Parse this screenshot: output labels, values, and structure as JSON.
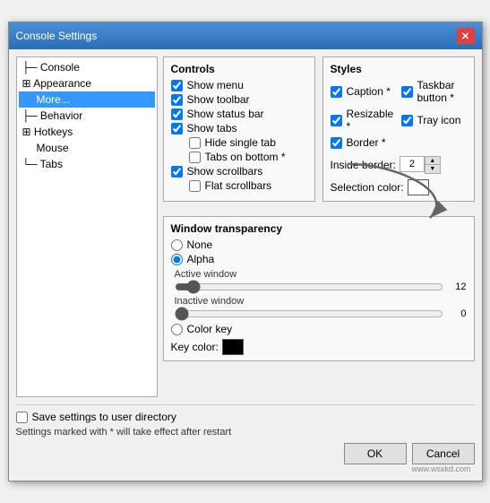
{
  "window": {
    "title": "Console Settings",
    "close_label": "✕"
  },
  "sidebar": {
    "items": [
      {
        "label": "Console",
        "level": 1,
        "prefix": "├─"
      },
      {
        "label": "Appearance",
        "level": 1,
        "prefix": "├─"
      },
      {
        "label": "More...",
        "level": 2,
        "selected": true
      },
      {
        "label": "Behavior",
        "level": 1,
        "prefix": "├─"
      },
      {
        "label": "Hotkeys",
        "level": 1,
        "prefix": "├─"
      },
      {
        "label": "Mouse",
        "level": 2,
        "prefix": ""
      },
      {
        "label": "Tabs",
        "level": 1,
        "prefix": "└─"
      }
    ]
  },
  "controls": {
    "title": "Controls",
    "items": [
      {
        "label": "Show menu",
        "checked": true,
        "indent": 0
      },
      {
        "label": "Show toolbar",
        "checked": true,
        "indent": 0
      },
      {
        "label": "Show status bar",
        "checked": true,
        "indent": 0
      },
      {
        "label": "Show tabs",
        "checked": true,
        "indent": 0
      },
      {
        "label": "Hide single tab",
        "checked": false,
        "indent": 1
      },
      {
        "label": "Tabs on bottom *",
        "checked": false,
        "indent": 1
      },
      {
        "label": "Show scrollbars",
        "checked": true,
        "indent": 0
      },
      {
        "label": "Flat scrollbars",
        "checked": false,
        "indent": 1
      }
    ]
  },
  "styles": {
    "title": "Styles",
    "items": [
      {
        "label": "Caption *",
        "checked": true
      },
      {
        "label": "Taskbar button *",
        "checked": true
      },
      {
        "label": "Resizable *",
        "checked": true
      },
      {
        "label": "Tray icon",
        "checked": true
      },
      {
        "label": "Border *",
        "checked": true
      }
    ],
    "inside_border_label": "Inside border:",
    "inside_border_value": "2",
    "selection_color_label": "Selection color:"
  },
  "transparency": {
    "title": "Window transparency",
    "options": [
      {
        "label": "None",
        "checked": false
      },
      {
        "label": "Alpha",
        "checked": true
      },
      {
        "label": "Color key",
        "checked": false
      }
    ],
    "active_window_label": "Active window",
    "active_value": 12,
    "inactive_window_label": "Inactive window",
    "inactive_value": 0,
    "key_color_label": "Key color:"
  },
  "footer": {
    "save_label": "Save settings to user directory",
    "note": "Settings marked with * will take effect after restart",
    "ok_label": "OK",
    "cancel_label": "Cancel"
  },
  "watermark": "www.wsxkd.com"
}
